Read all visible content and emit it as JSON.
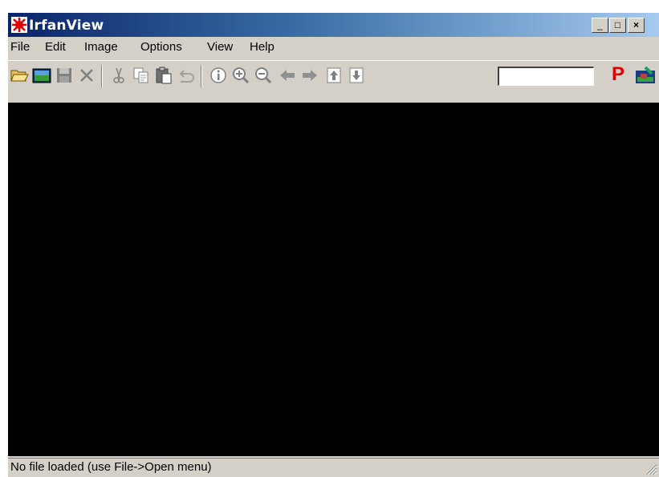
{
  "window": {
    "title": "IrfanView"
  },
  "menu": [
    {
      "label": "File"
    },
    {
      "label": "Edit"
    },
    {
      "label": "Image"
    },
    {
      "label": "Options"
    },
    {
      "label": "View"
    },
    {
      "label": "Help"
    }
  ],
  "toolbar": {
    "zoom_value": "",
    "plugin_label": "P",
    "buttons": [
      "open-folder",
      "thumbnails",
      "save",
      "delete",
      "cut",
      "copy",
      "paste",
      "undo",
      "info",
      "zoom-in",
      "zoom-out",
      "previous",
      "next",
      "first",
      "last",
      "plugin",
      "paint"
    ]
  },
  "caption_buttons": {
    "minimize": "_",
    "maximize": "□",
    "close": "×"
  },
  "status": {
    "text": "No file loaded (use File->Open menu)"
  },
  "colors": {
    "title_left": "#0a246a",
    "title_right": "#a6caf0",
    "face": "#d4d0c8",
    "canvas": "#000000",
    "plugin_p": "#e00000"
  }
}
